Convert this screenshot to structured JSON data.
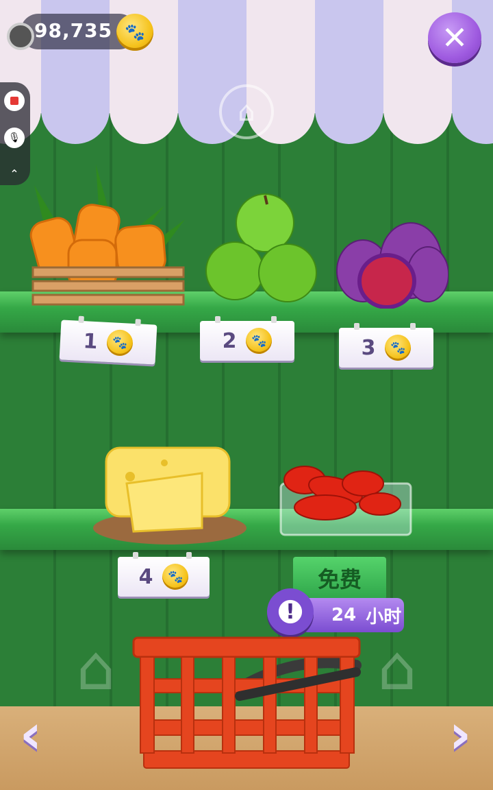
{
  "hud": {
    "coins": "98,735",
    "coin_icon": "paw-coin-icon",
    "close_icon": "close-icon",
    "home_icon": "home-icon"
  },
  "shelf_items": [
    {
      "name": "carrots",
      "price": "1"
    },
    {
      "name": "green-apples",
      "price": "2"
    },
    {
      "name": "figs",
      "price": "3"
    },
    {
      "name": "cheese",
      "price": "4"
    },
    {
      "name": "chili-peppers",
      "free_label": "免费",
      "timer_value": "24",
      "timer_unit": "小时"
    }
  ],
  "navigation": {
    "left_icon": "chevron-left-icon",
    "right_icon": "chevron-right-icon"
  },
  "colors": {
    "shelf": "#35a847",
    "wall": "#2c7f37",
    "awning_purple": "#c9c6ee",
    "awning_white": "#f1e6ee",
    "basket": "#e5451f"
  }
}
